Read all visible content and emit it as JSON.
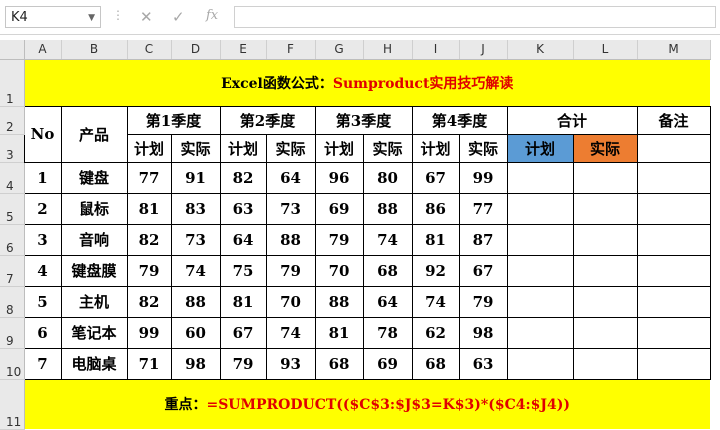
{
  "formula_bar": {
    "name_box": "K4",
    "cancel_icon": "✕",
    "enter_icon": "✓",
    "fx_icon": "fx",
    "formula": ""
  },
  "columns": [
    "A",
    "B",
    "C",
    "D",
    "E",
    "F",
    "G",
    "H",
    "I",
    "J",
    "K",
    "L",
    "M"
  ],
  "rows": [
    "1",
    "2",
    "3",
    "4",
    "5",
    "6",
    "7",
    "8",
    "9",
    "10",
    "11"
  ],
  "title": {
    "prefix": "Excel函数公式：",
    "highlight": "Sumproduct实用技巧解读"
  },
  "headers": {
    "no": "No",
    "product": "产品",
    "q1": "第1季度",
    "q2": "第2季度",
    "q3": "第3季度",
    "q4": "第4季度",
    "total": "合计",
    "remark": "备注",
    "plan": "计划",
    "actual": "实际"
  },
  "table": [
    {
      "no": "1",
      "product": "键盘",
      "vals": [
        "77",
        "91",
        "82",
        "64",
        "96",
        "80",
        "67",
        "99"
      ]
    },
    {
      "no": "2",
      "product": "鼠标",
      "vals": [
        "81",
        "83",
        "63",
        "73",
        "69",
        "88",
        "86",
        "77"
      ]
    },
    {
      "no": "3",
      "product": "音响",
      "vals": [
        "82",
        "73",
        "64",
        "88",
        "79",
        "74",
        "81",
        "87"
      ]
    },
    {
      "no": "4",
      "product": "键盘膜",
      "vals": [
        "79",
        "74",
        "75",
        "79",
        "70",
        "68",
        "92",
        "67"
      ]
    },
    {
      "no": "5",
      "product": "主机",
      "vals": [
        "82",
        "88",
        "81",
        "70",
        "88",
        "64",
        "74",
        "79"
      ]
    },
    {
      "no": "6",
      "product": "笔记本",
      "vals": [
        "99",
        "60",
        "67",
        "74",
        "81",
        "78",
        "62",
        "98"
      ]
    },
    {
      "no": "7",
      "product": "电脑桌",
      "vals": [
        "71",
        "98",
        "79",
        "93",
        "68",
        "69",
        "68",
        "63"
      ]
    }
  ],
  "footer": {
    "prefix": "重点：",
    "formula": "=SUMPRODUCT(($C$3:$J$3=K$3)*($C4:$J4))"
  },
  "colors": {
    "plan": "#5b9bd5",
    "actual": "#ed7d31",
    "highlight": "#ffff00",
    "red": "#e00000"
  }
}
